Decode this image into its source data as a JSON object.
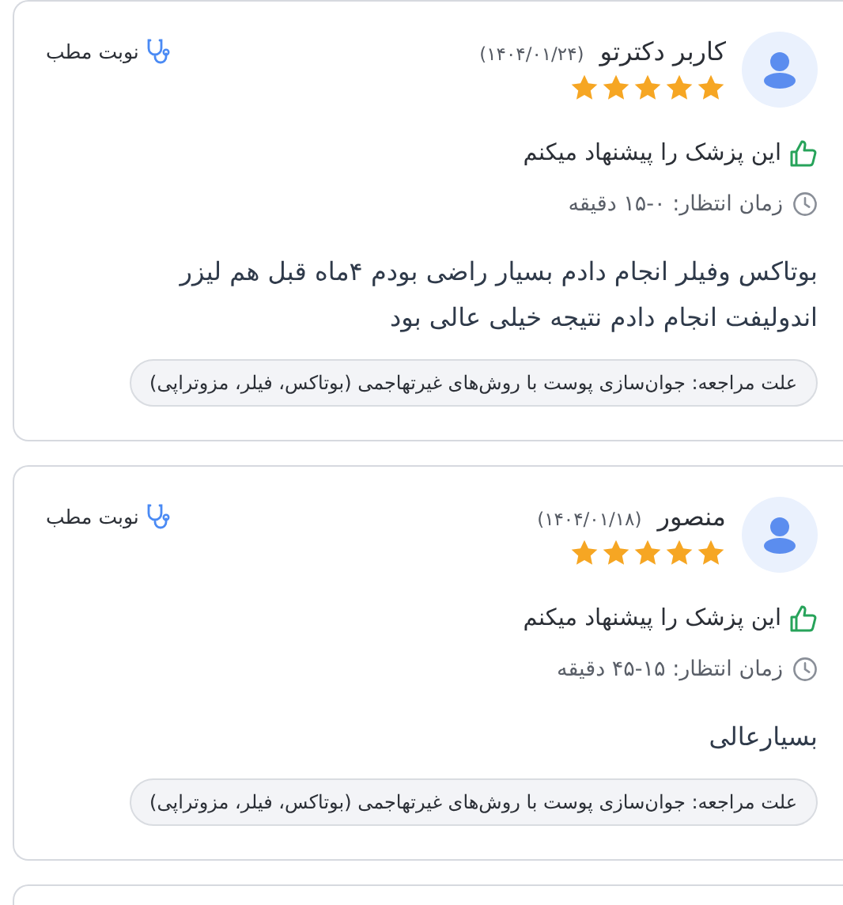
{
  "reviews": [
    {
      "author": "کاربر دکترتو",
      "date": "(۱۴۰۴/۰۱/۲۴)",
      "stars": 5,
      "appointment": "نوبت مطب",
      "recommendation": "این پزشک را پیشنهاد میکنم",
      "wait_time": "زمان انتظار: ۰-۱۵ دقیقه",
      "comment": "بوتاکس وفیلر انجام دادم بسیار راضی بودم ۴ماه قبل هم لیزر اندولیفت انجام دادم نتیجه خیلی عالی بود",
      "reason": "علت مراجعه: جوان‌سازی پوست با روش‌های غیرتهاجمی (بوتاکس، فیلر، مزوتراپی)"
    },
    {
      "author": "منصور",
      "date": "(۱۴۰۴/۰۱/۱۸)",
      "stars": 5,
      "appointment": "نوبت مطب",
      "recommendation": "این پزشک را پیشنهاد میکنم",
      "wait_time": "زمان انتظار: ۱۵-۴۵ دقیقه",
      "comment": "بسیارعالی",
      "reason": "علت مراجعه: جوان‌سازی پوست با روش‌های غیرتهاجمی (بوتاکس، فیلر، مزوتراپی)"
    }
  ]
}
